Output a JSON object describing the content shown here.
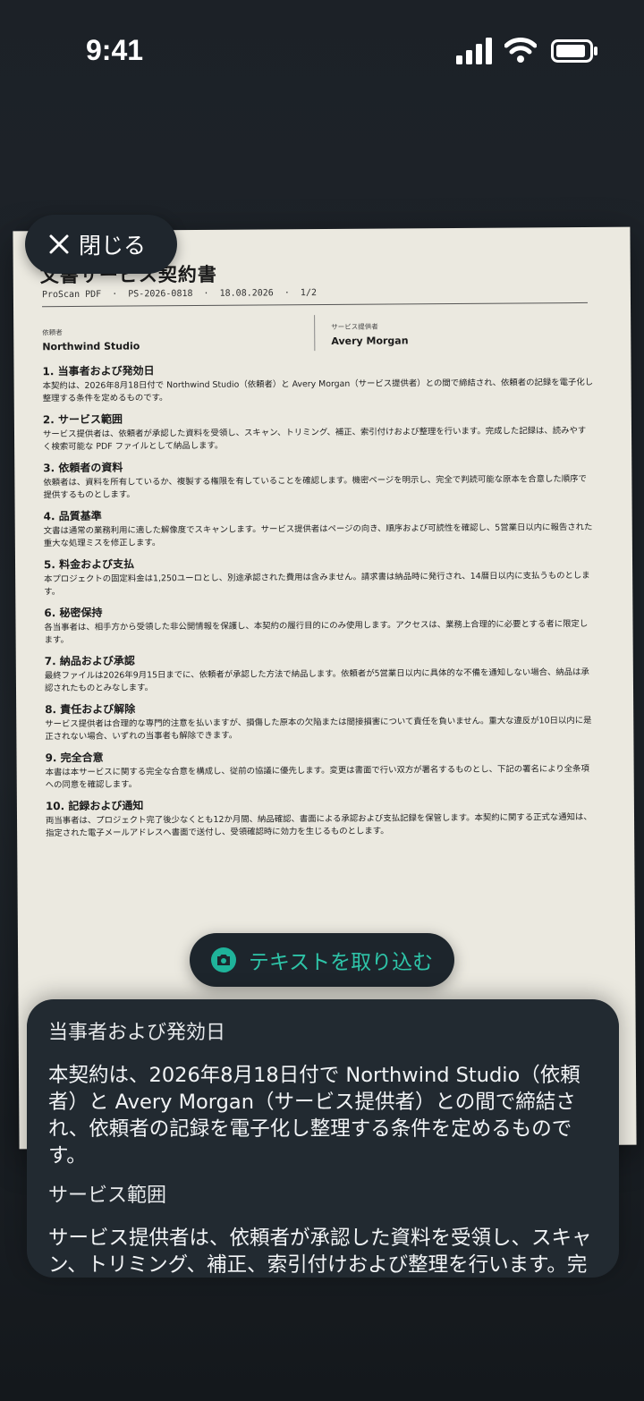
{
  "status": {
    "time": "9:41"
  },
  "close_button": {
    "label": "閉じる"
  },
  "document": {
    "title": "文書サービス契約書",
    "meta": "ProScan PDF  ·  PS-2026-0818  ·  18.08.2026  ·  1/2",
    "client_label": "依頼者",
    "client_name": "Northwind Studio",
    "provider_label": "サービス提供者",
    "provider_name": "Avery Morgan",
    "clauses": [
      {
        "title": "1. 当事者および発効日",
        "body": "本契約は、2026年8月18日付で Northwind Studio（依頼者）と Avery Morgan（サービス提供者）との間で締結され、依頼者の記録を電子化し整理する条件を定めるものです。"
      },
      {
        "title": "2. サービス範囲",
        "body": "サービス提供者は、依頼者が承認した資料を受領し、スキャン、トリミング、補正、索引付けおよび整理を行います。完成した記録は、読みやすく検索可能な PDF ファイルとして納品します。"
      },
      {
        "title": "3. 依頼者の資料",
        "body": "依頼者は、資料を所有しているか、複製する権限を有していることを確認します。機密ページを明示し、完全で判読可能な原本を合意した順序で提供するものとします。"
      },
      {
        "title": "4. 品質基準",
        "body": "文書は通常の業務利用に適した解像度でスキャンします。サービス提供者はページの向き、順序および可読性を確認し、5営業日以内に報告された重大な処理ミスを修正します。"
      },
      {
        "title": "5. 料金および支払",
        "body": "本プロジェクトの固定料金は1,250ユーロとし、別途承認された費用は含みません。請求書は納品時に発行され、14暦日以内に支払うものとします。"
      },
      {
        "title": "6. 秘密保持",
        "body": "各当事者は、相手方から受領した非公開情報を保護し、本契約の履行目的にのみ使用します。アクセスは、業務上合理的に必要とする者に限定します。"
      },
      {
        "title": "7. 納品および承認",
        "body": "最終ファイルは2026年9月15日までに、依頼者が承認した方法で納品します。依頼者が5営業日以内に具体的な不備を通知しない場合、納品は承認されたものとみなします。"
      },
      {
        "title": "8. 責任および解除",
        "body": "サービス提供者は合理的な専門的注意を払いますが、損傷した原本の欠陥または間接損害について責任を負いません。重大な違反が10日以内に是正されない場合、いずれの当事者も解除できます。"
      },
      {
        "title": "9. 完全合意",
        "body": "本書は本サービスに関する完全な合意を構成し、従前の協議に優先します。変更は書面で行い双方が署名するものとし、下記の署名により全条項への同意を確認します。"
      },
      {
        "title": "10. 記録および通知",
        "body": "両当事者は、プロジェクト完了後少なくとも12か月間、納品確認、書面による承認および支払記録を保管します。本契約に関する正式な通知は、指定された電子メールアドレスへ書面で送付し、受領確認時に効力を生じるものとします。"
      }
    ]
  },
  "capture_button": {
    "label": "テキストを取り込む",
    "accent": "#2ec4a8"
  },
  "extracted": [
    {
      "heading": "当事者および発効日",
      "body": "本契約は、2026年8月18日付で Northwind Studio（依頼者）と Avery Morgan（サービス提供者）との間で締結され、依頼者の記録を電子化し整理する条件を定めるものです。"
    },
    {
      "heading": "サービス範囲",
      "body": "サービス提供者は、依頼者が承認した資料を受領し、スキャン、トリミング、補正、索引付けおよび整理を行います。完成した記録は、読みやすく検索可能な PDF"
    }
  ]
}
